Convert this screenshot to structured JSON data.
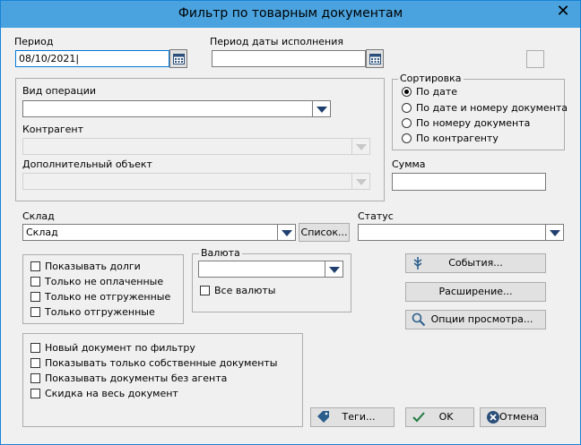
{
  "window": {
    "title": "Фильтр по товарным документам",
    "close": "✕"
  },
  "period": {
    "label": "Период",
    "value": "08/10/2021"
  },
  "exec_period": {
    "label": "Период даты исполнения",
    "value": ""
  },
  "operation": {
    "label": "Вид операции",
    "value": ""
  },
  "contractor": {
    "label": "Контрагент",
    "value": ""
  },
  "extra_object": {
    "label": "Дополнительный объект",
    "value": ""
  },
  "sort": {
    "title": "Сортировка",
    "options": [
      "По дате",
      "По дате и номеру документа",
      "По номеру документа",
      "По контрагенту"
    ],
    "selected": 0
  },
  "sum": {
    "label": "Сумма",
    "value": ""
  },
  "warehouse": {
    "label": "Склад",
    "value": "Склад",
    "list_button": "Список..."
  },
  "status": {
    "label": "Статус",
    "value": ""
  },
  "debts": {
    "items": [
      "Показывать долги",
      "Только не оплаченные",
      "Только не отгруженные",
      "Только отгруженные"
    ]
  },
  "currency": {
    "title": "Валюта",
    "value": "",
    "all_label": "Все валюты"
  },
  "buttons": {
    "events": "События...",
    "extension": "Расширение...",
    "view_options": "Опции просмотра...",
    "tags": "Теги...",
    "ok": "OK",
    "cancel": "Отмена"
  },
  "misc": {
    "items": [
      "Новый документ по фильтру",
      "Показывать только собственные документы",
      "Показывать документы без агента",
      "Скидка на весь документ"
    ]
  },
  "colors": {
    "titlebar": "#4aa3df",
    "accent": "#0078d7"
  }
}
